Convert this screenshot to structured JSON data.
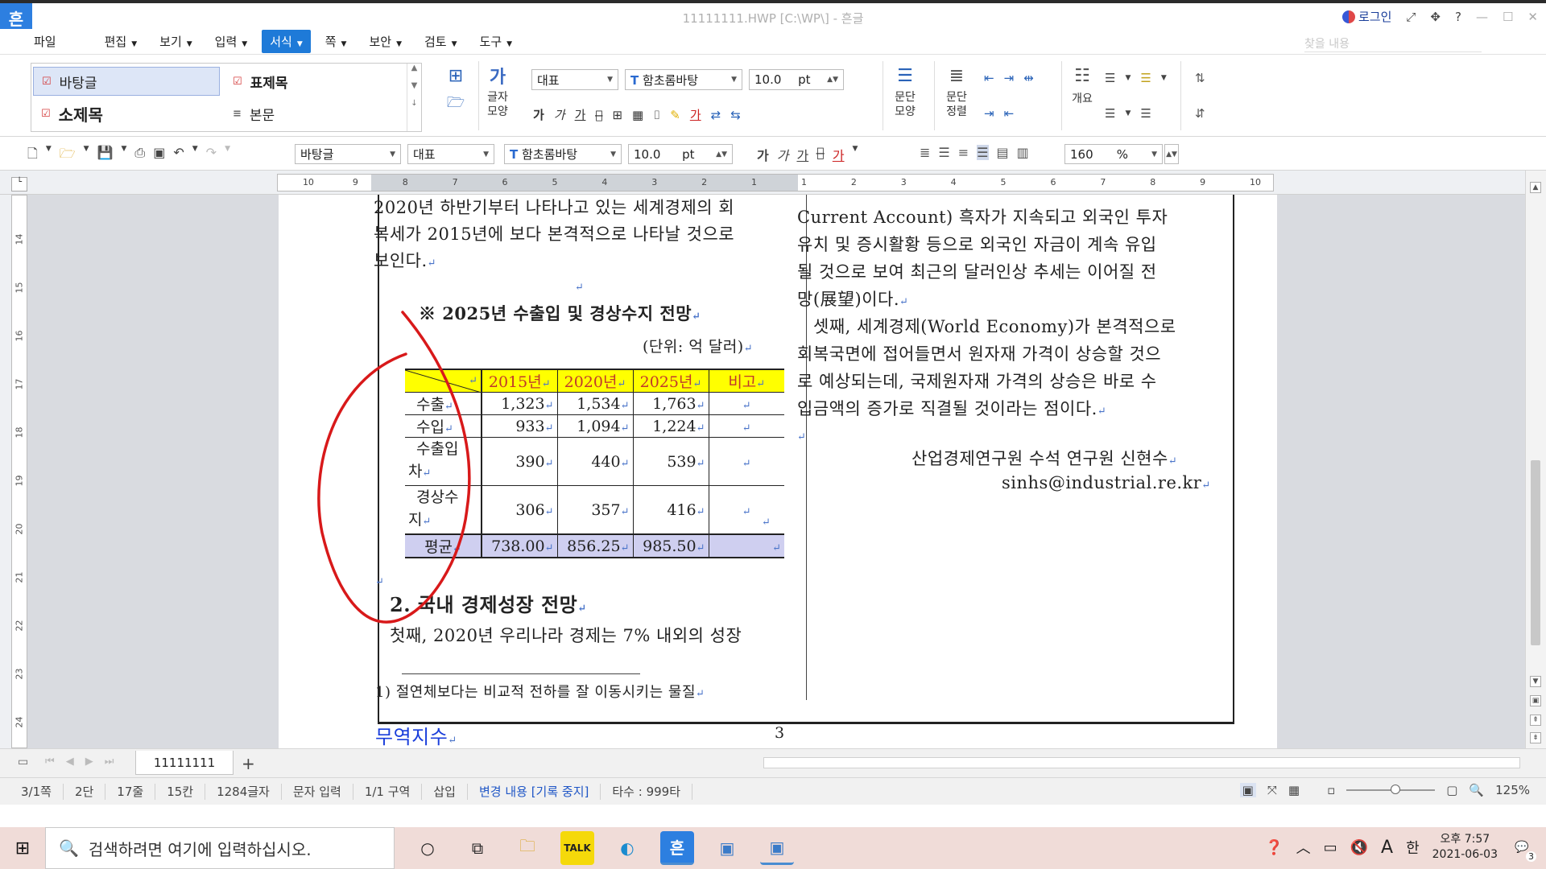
{
  "window": {
    "app_logo": "흔",
    "title": "11111111.HWP [C:\\WP\\] - 흔글",
    "login_label": "로그인",
    "controls": [
      "⤢",
      "✥",
      "?",
      "—",
      "☐",
      "✕"
    ]
  },
  "menu": {
    "items": [
      {
        "label": "파일",
        "caret": false
      },
      {
        "label": "편집",
        "caret": true
      },
      {
        "label": "보기",
        "caret": true
      },
      {
        "label": "입력",
        "caret": true
      },
      {
        "label": "서식",
        "caret": true,
        "active": true
      },
      {
        "label": "쪽",
        "caret": true
      },
      {
        "label": "보안",
        "caret": true
      },
      {
        "label": "검토",
        "caret": true
      },
      {
        "label": "도구",
        "caret": true
      }
    ],
    "search_placeholder": "찾을 내용"
  },
  "ribbon": {
    "styles": [
      {
        "label": "바탕글",
        "selected": true
      },
      {
        "label": "표제목",
        "selected": false
      },
      {
        "label": "소제목",
        "selected": false
      },
      {
        "label": "본문",
        "selected": false
      }
    ],
    "char_shape_label": "글자\n모양",
    "style_select": "대표",
    "font_select": "함초롬바탕",
    "size_value": "10.0",
    "size_unit": "pt",
    "para_shape_label": "문단\n모양",
    "para_align_label": "문단\n정렬",
    "outline_label": "개요"
  },
  "toolbar": {
    "style_field": "바탕글",
    "lang_field": "대표",
    "font_field": "함초롬바탕",
    "size_field": "10.0",
    "size_unit": "pt",
    "zoom_field": "160",
    "zoom_unit": "%"
  },
  "ruler": {
    "h_numbers": [
      "10",
      "9",
      "8",
      "7",
      "6",
      "5",
      "4",
      "3",
      "2",
      "1",
      "1",
      "2",
      "3",
      "4",
      "5",
      "6",
      "7",
      "8",
      "9",
      "10"
    ],
    "v_numbers": [
      "14",
      "15",
      "16",
      "17",
      "18",
      "19",
      "20",
      "21",
      "22",
      "23",
      "24"
    ]
  },
  "document": {
    "left_lines": [
      "2020년 하반기부터 나타나고 있는 세계경제의 회",
      "복세가 2015년에 보다 본격적으로 나타날 것으로",
      "보인다."
    ],
    "table_title": "※ 2025년 수출입 및 경상수지 전망",
    "unit_note": "(단위: 억 달러)",
    "table": {
      "headers": [
        "",
        "2015년",
        "2020년",
        "2025년",
        "비고"
      ],
      "rows": [
        {
          "label": "수출",
          "values": [
            "1,323",
            "1,534",
            "1,763",
            ""
          ]
        },
        {
          "label": "수입",
          "values": [
            "933",
            "1,094",
            "1,224",
            ""
          ]
        },
        {
          "label": "수출입\n차",
          "values": [
            "390",
            "440",
            "539",
            ""
          ]
        },
        {
          "label": "경상수\n지",
          "values": [
            "306",
            "357",
            "416",
            ""
          ]
        }
      ],
      "avg": {
        "label": "평균",
        "values": [
          "738.00",
          "856.25",
          "985.50",
          ""
        ]
      }
    },
    "section_heading": "2. 국내 경제성장 전망",
    "section_line": "첫째, 2020년 우리나라 경제는 7% 내외의 성장",
    "footnote": "1) 절연체보다는 비교적 전하를 잘 이동시키는 물질",
    "footer_term": "무역지수",
    "page_number": "3",
    "right_lines": [
      "Current Account) 흑자가 지속되고 외국인 투자",
      "유치 및 증시활황 등으로 외국인 자금이 계속 유입",
      "될 것으로 보여 최근의 달러인상 추세는 이어질 전",
      "망(展望)이다.",
      "셋째, 세계경제(World Economy)가 본격적으로",
      "회복국면에 접어들면서 원자재 가격이 상승할 것으",
      "로 예상되는데, 국제원자재 가격의 상승은 바로 수",
      "입금액의 증가로 직결될 것이라는 점이다."
    ],
    "right_link_word": "직결",
    "author": "산업경제연구원 수석 연구원 신현수",
    "email": "sinhs@industrial.re.kr"
  },
  "tabs": {
    "sheet_name": "11111111"
  },
  "status": {
    "items": [
      "3/1쪽",
      "2단",
      "17줄",
      "15칸",
      "1284글자",
      "문자 입력",
      "1/1 구역",
      "삽입",
      "변경 내용 [기록 중지]",
      "타수 : 999타"
    ],
    "zoom": "125%"
  },
  "taskbar": {
    "search_placeholder": "검색하려면 여기에 입력하십시오.",
    "time": "오후 7:57",
    "date": "2021-06-03",
    "ime": "한",
    "notifications": "3"
  },
  "colors": {
    "accent": "#1e7ad8",
    "table_header_bg": "#ffff00",
    "table_avg_bg": "#cfcff0",
    "annotation_red": "#d8191a"
  }
}
